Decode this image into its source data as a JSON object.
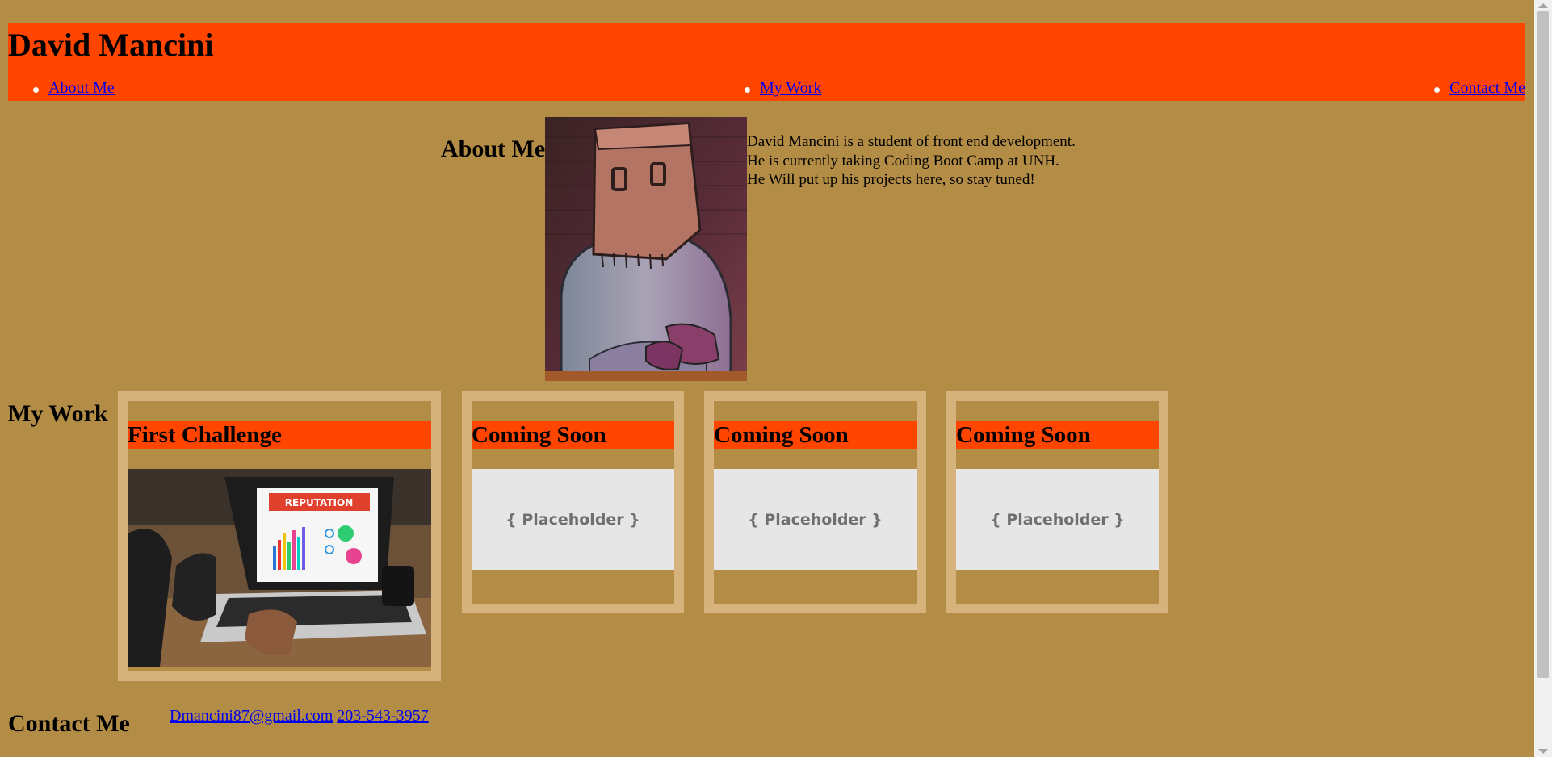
{
  "header": {
    "title": "David Mancini",
    "nav": [
      {
        "label": "About Me"
      },
      {
        "label": "My Work"
      },
      {
        "label": "Contact Me"
      }
    ]
  },
  "about": {
    "heading": "About Me",
    "lines": [
      "David Mancini is a student of front end development.",
      "He is currently taking Coding Boot Camp at UNH.",
      "He Will put up his projects here, so stay tuned!"
    ]
  },
  "work": {
    "heading": "My Work",
    "cards": [
      {
        "title": "First Challenge",
        "image_text": "REPUTATION"
      },
      {
        "title": "Coming Soon",
        "placeholder": "{ Placeholder }"
      },
      {
        "title": "Coming Soon",
        "placeholder": "{ Placeholder }"
      },
      {
        "title": "Coming Soon",
        "placeholder": "{ Placeholder }"
      }
    ]
  },
  "contact": {
    "heading": "Contact Me",
    "email": "Dmancini87@gmail.com",
    "phone": "203-543-3957"
  },
  "colors": {
    "background": "#b38c45",
    "accent": "#ff4500",
    "card_border": "#d6b27d",
    "link": "#0000ee"
  }
}
